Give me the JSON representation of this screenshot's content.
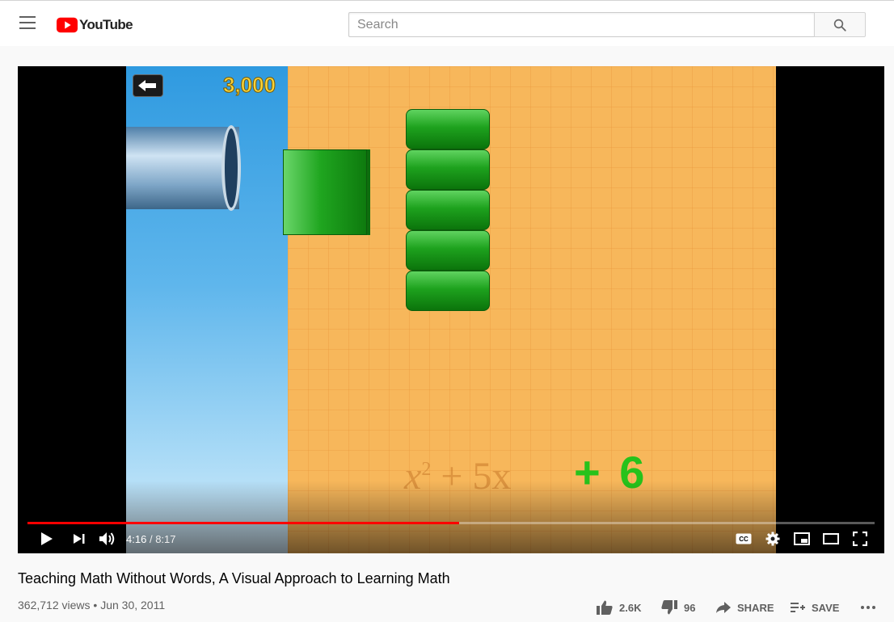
{
  "header": {
    "logo_text": "YouTube",
    "search_placeholder": "Search",
    "icons": {
      "menu": "hamburger-menu-icon",
      "search": "search-icon",
      "logo": "youtube-play-icon"
    }
  },
  "colors": {
    "brand_red": "#ff0000",
    "progress_red": "#ff0000",
    "page_bg": "#f9f9f9"
  },
  "video_frame": {
    "score": "3,000",
    "equation_parts": {
      "x": "x",
      "sq": "2",
      "plus": "+",
      "five_x": "5x"
    },
    "highlight": "+ 6"
  },
  "player": {
    "progress_fraction": 0.51,
    "current_time": "4:16",
    "separator": "/",
    "duration": "8:17",
    "controls": [
      "play-icon",
      "next-icon",
      "volume-icon",
      "captions-icon",
      "settings-icon",
      "miniplayer-icon",
      "theater-mode-icon",
      "fullscreen-icon"
    ]
  },
  "video": {
    "title": "Teaching Math Without Words, A Visual Approach to Learning Math",
    "views": "362,712 views",
    "dot": "•",
    "date": "Jun 30, 2011"
  },
  "actions": {
    "like_count": "2.6K",
    "dislike_count": "96",
    "share_label": "SHARE",
    "save_label": "SAVE"
  }
}
